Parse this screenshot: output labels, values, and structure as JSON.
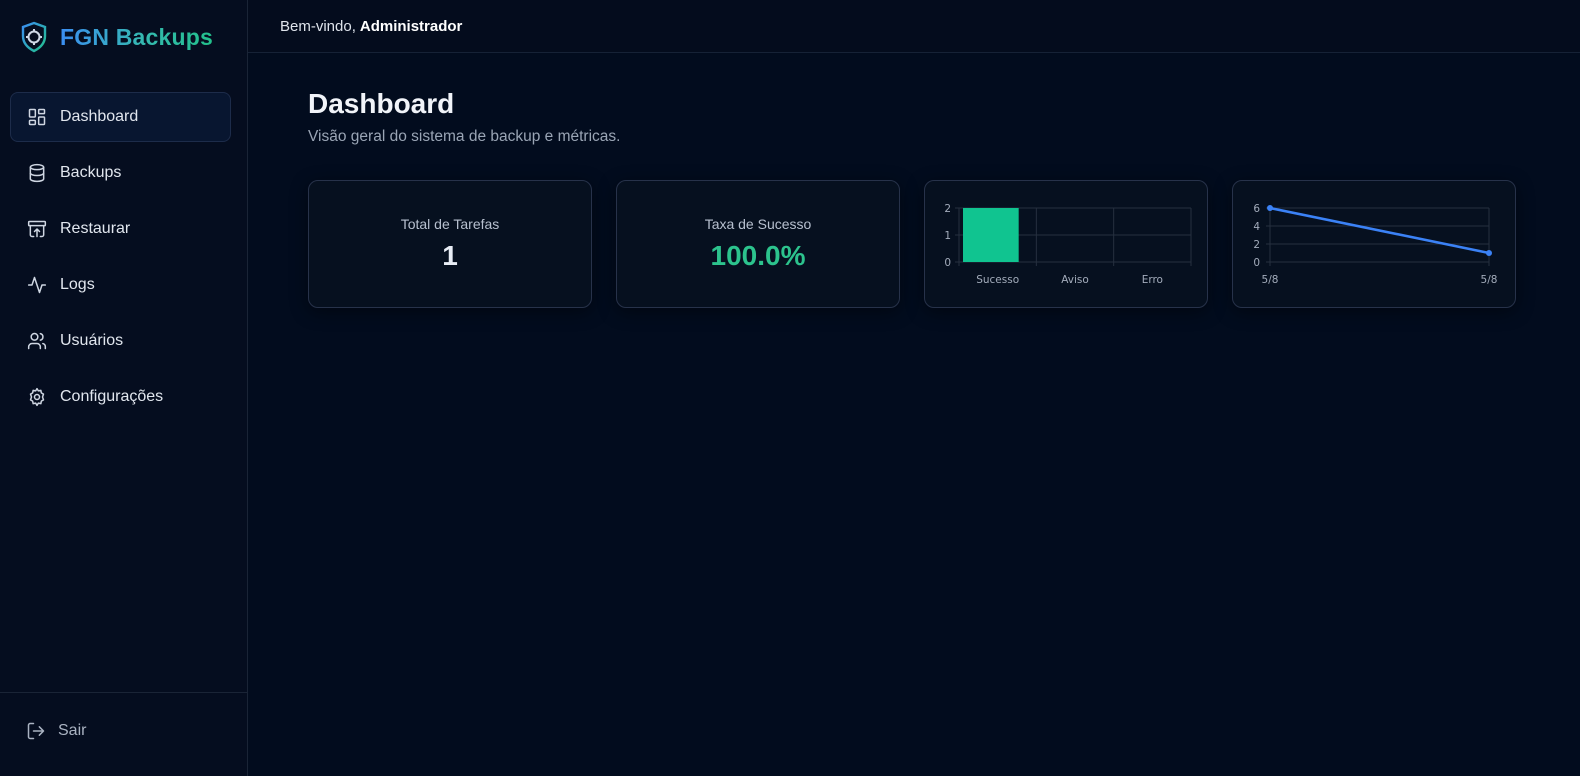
{
  "app": {
    "name": "FGN Backups"
  },
  "sidebar": {
    "items": [
      {
        "label": "Dashboard",
        "icon": "dashboard-grid-icon",
        "active": true
      },
      {
        "label": "Backups",
        "icon": "database-icon"
      },
      {
        "label": "Restaurar",
        "icon": "archive-restore-icon"
      },
      {
        "label": "Logs",
        "icon": "activity-icon"
      },
      {
        "label": "Usuários",
        "icon": "users-icon"
      },
      {
        "label": "Configurações",
        "icon": "gear-icon"
      }
    ],
    "logout_label": "Sair"
  },
  "header": {
    "welcome_prefix": "Bem-vindo,",
    "user_name": "Administrador"
  },
  "page": {
    "title": "Dashboard",
    "subtitle": "Visão geral do sistema de backup e métricas."
  },
  "stats": {
    "total_tasks": {
      "label": "Total de Tarefas",
      "value": "1"
    },
    "success_rate": {
      "label": "Taxa de Sucesso",
      "value": "100.0%"
    }
  },
  "colors": {
    "accent_green": "#2cc38d",
    "accent_blue": "#3b82f6",
    "background": "#020c1e",
    "card_border": "#27324a"
  },
  "chart_data": [
    {
      "type": "bar",
      "title": "",
      "categories": [
        "Sucesso",
        "Aviso",
        "Erro"
      ],
      "values": [
        2,
        0,
        0
      ],
      "ylim": [
        0,
        2
      ],
      "yticks": [
        0,
        1,
        2
      ],
      "grid": true,
      "color": "#10c490"
    },
    {
      "type": "line",
      "title": "",
      "x": [
        "5/8",
        "5/8"
      ],
      "values": [
        6,
        1
      ],
      "ylim": [
        0,
        6
      ],
      "yticks": [
        0,
        2,
        4,
        6
      ],
      "grid": true,
      "color": "#3b82f6"
    }
  ]
}
